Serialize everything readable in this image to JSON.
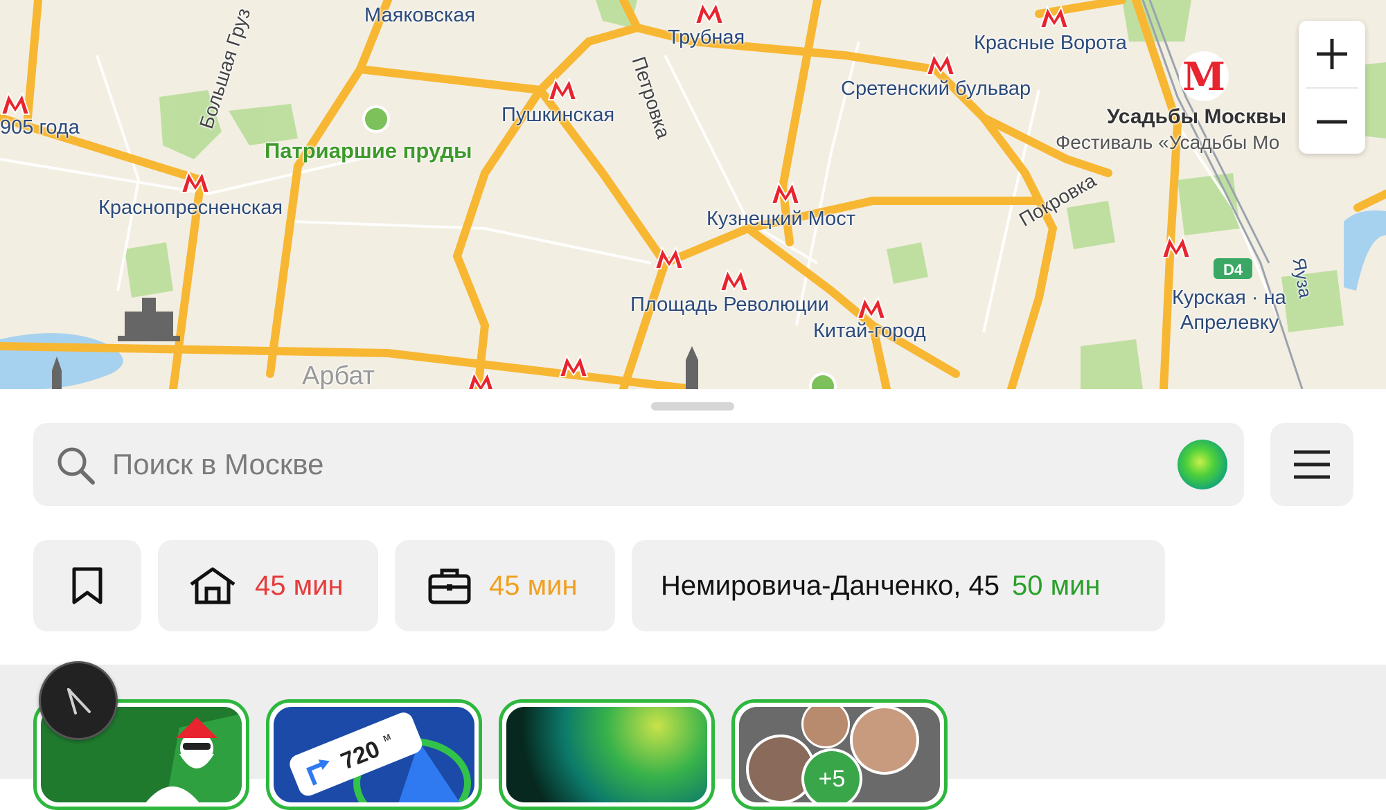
{
  "map": {
    "labels": {
      "mayakovskaya": "Маяковская",
      "trubnaya": "Трубная",
      "krasnye_vorota": "Красные Ворота",
      "year1905": "905 года",
      "bolshaya_gruz": "Большая Груз",
      "patriarshie": "Патриаршие пруды",
      "pushkinskaya": "Пушкинская",
      "petrovka": "Петровка",
      "sretensky": "Сретенский бульвар",
      "usadby_title": "Усадьбы Москвы",
      "usadby_sub": "Фестиваль «Усадьбы Мо",
      "krasnopresnenskaya": "Краснопресненская",
      "kuznetsky": "Кузнецкий Мост",
      "pokrovka": "Покровка",
      "ploshchad": "Площадь Революции",
      "kitay_gorod": "Китай-город",
      "kurskaya_1": "Курская · на",
      "kurskaya_2": "Апрелевку",
      "d4": "D4",
      "yauza": "Яуза",
      "arbat": "Арбат"
    },
    "zoom": {
      "in_icon": "plus-icon",
      "out_icon": "minus-icon"
    }
  },
  "search": {
    "placeholder": "Поиск в Москве",
    "icon": "search-icon",
    "assistant": "alice-icon"
  },
  "menu_icon": "hamburger-icon",
  "shortcuts": [
    {
      "icon": "bookmark-icon"
    },
    {
      "icon": "home-icon",
      "time": "45 мин",
      "time_color": "#e63b3b"
    },
    {
      "icon": "briefcase-icon",
      "time": "45 мин",
      "time_color": "#f0a020"
    },
    {
      "address": "Немировича-Данченко, 45",
      "time": "50 мин",
      "time_color": "#2ba02b"
    }
  ],
  "stories": [
    {
      "name": "santa-story"
    },
    {
      "name": "navigator-story",
      "distance": "720",
      "unit": "м"
    },
    {
      "name": "alice-story"
    },
    {
      "name": "friends-story",
      "badge": "+5"
    }
  ],
  "colors": {
    "road": "#f7b733",
    "park": "#a9d88a",
    "water": "#a7d2ef",
    "metro": "#e8242e"
  }
}
